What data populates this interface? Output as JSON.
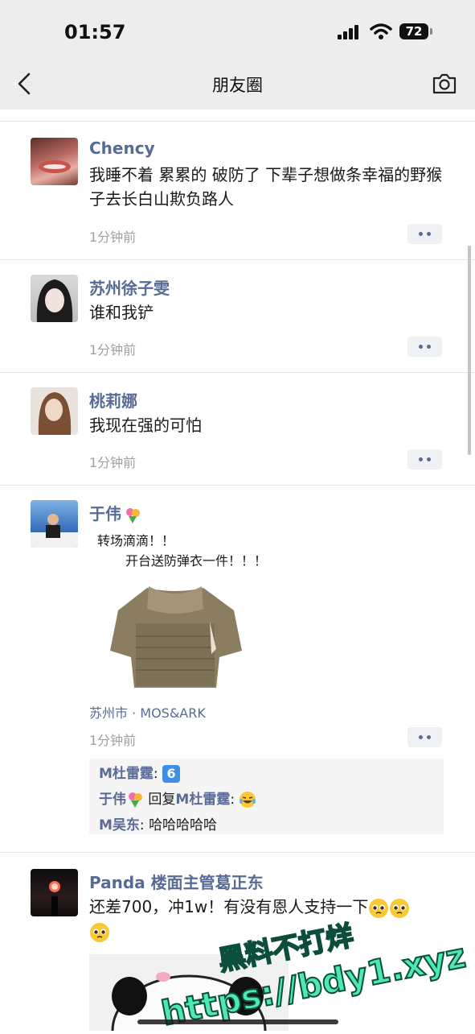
{
  "status_bar": {
    "time": "01:57",
    "battery": "72"
  },
  "nav": {
    "title": "朋友圈"
  },
  "posts": [
    {
      "name": "Chency",
      "text": "我睡不着 累累的 破防了 下辈子想做条幸福的野猴子去长白山欺负路人",
      "time": "1分钟前"
    },
    {
      "name": "苏州徐子雯",
      "text": "谁和我铲",
      "time": "1分钟前"
    },
    {
      "name": "桃莉娜",
      "text": "我现在强的可怕",
      "time": "1分钟前"
    },
    {
      "name": "于伟",
      "caption_line1": "转场滴滴！！",
      "caption_line2": "开台送防弹衣一件！！！",
      "location": "苏州市 · MOS&ARK",
      "time": "1分钟前",
      "comments": [
        {
          "user": "M杜雷霆",
          "sep": ": ",
          "badge": "6"
        },
        {
          "user": "于伟",
          "reply_word": " 回复",
          "target": "M杜雷霆",
          "sep": ": "
        },
        {
          "user": "M吴东",
          "sep": ": ",
          "content": "哈哈哈哈哈"
        }
      ]
    },
    {
      "name": "Panda 楼面主管葛正东",
      "text": "还差700，冲1w！有没有恩人支持一下"
    }
  ],
  "watermark": {
    "line1": "黑料不打烊",
    "line2": "https://bdy1.xyz"
  },
  "colors": {
    "link": "#576b95",
    "topbar": "#ededed",
    "watermark": "#4ee8b4"
  }
}
